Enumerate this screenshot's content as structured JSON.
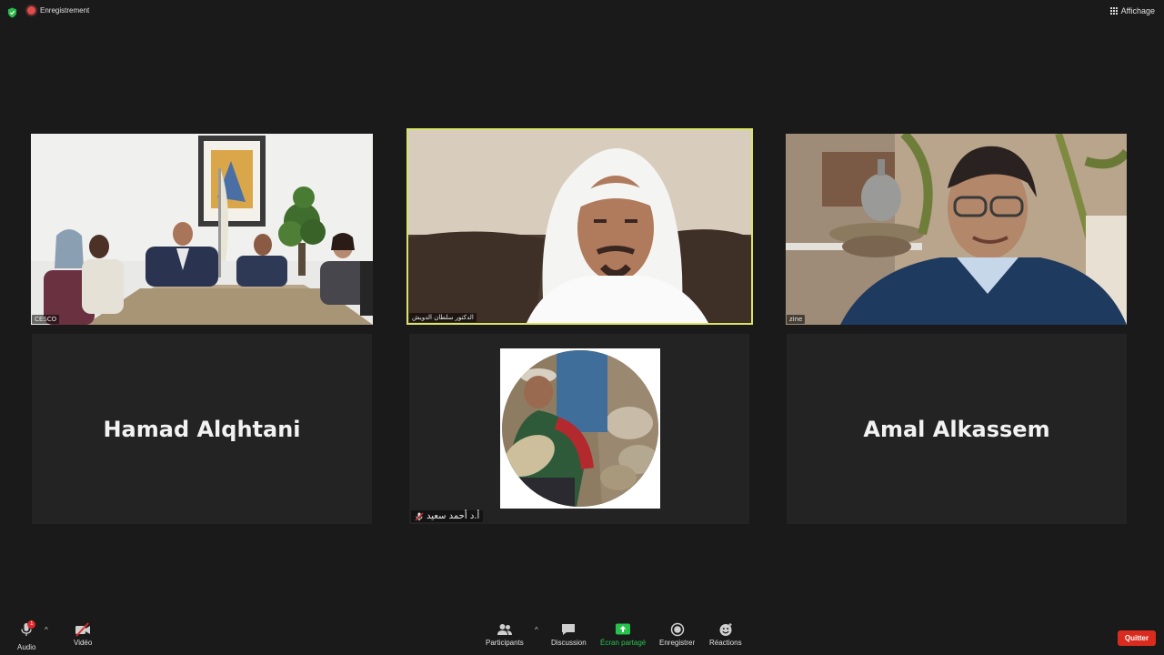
{
  "topbar": {
    "recording_label": "Enregistrement",
    "view_label": "Affichage"
  },
  "tiles": {
    "t1": {
      "name_tag": "CESCO"
    },
    "t2": {
      "name_tag": "الدكتور سلطان الدويش"
    },
    "t3": {
      "name_tag": "zine"
    },
    "t4": {
      "name": "Hamad Alqhtani"
    },
    "t5": {
      "name_tag": "أ.د أحمد سعيد"
    },
    "t6": {
      "name": "Amal Alkassem"
    }
  },
  "toolbar": {
    "audio_label": "Audio",
    "audio_badge": "1",
    "video_label": "Vidéo",
    "participants_label": "Participants",
    "chat_label": "Discussion",
    "share_label": "Écran partagé",
    "record_label": "Enregistrer",
    "reactions_label": "Réactions",
    "quit_label": "Quitter"
  },
  "colors": {
    "background": "#1a1a1a",
    "active_speaker_border": "#d8e36a",
    "share_green": "#27c24c",
    "quit_red": "#d92c1e",
    "recording_red": "#e14d4d"
  }
}
